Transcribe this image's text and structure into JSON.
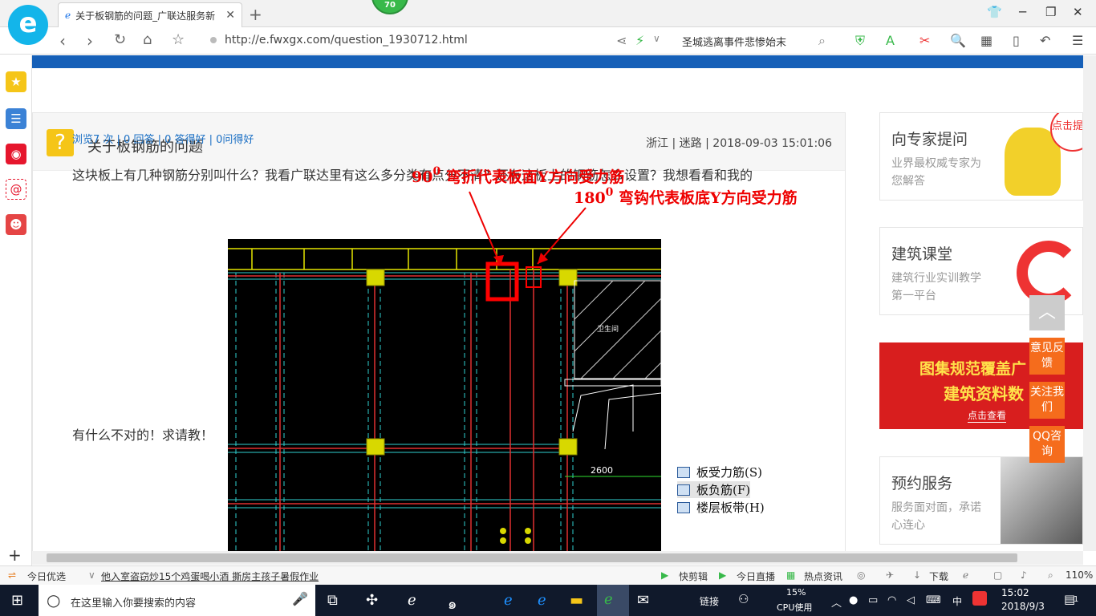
{
  "browser": {
    "tab_title": "关于板钢筋的问题_广联达服务新",
    "badge": "70",
    "url": "http://e.fwxgx.com/question_1930712.html",
    "search_text": "圣城逃离事件悲惨始末"
  },
  "question": {
    "title": "关于板钢筋的问题",
    "meta": "浙江 | 迷路 | 2018-09-03 15:01:06",
    "stats": "浏览7 次 | 0 回答 | 0 答得好 | 0问得好",
    "body_line1": "这块板上有几种钢筋分别叫什么？我看广联达里有这么多分类有点分不清？还有这板上的钢筋怎么设置？我想看看和我的",
    "body_line2": "有什么不对的！求请教！"
  },
  "image": {
    "annotation1_num": "90",
    "annotation1_sup": "0",
    "annotation1_text": "弯折代表板面Y方向受力筋",
    "annotation2_num": "180",
    "annotation2_sup": "0",
    "annotation2_text": "弯钩代表板底Y方向受力筋",
    "room_label": "卫生间",
    "dimension": "2600",
    "legend": [
      "板受力筋(S)",
      "板负筋(F)",
      "楼层板带(H)"
    ]
  },
  "sidebar": {
    "cards": [
      {
        "title": "向专家提问",
        "sub": "业界最权威专家为您解答"
      },
      {
        "title": "建筑课堂",
        "sub": "建筑行业实训教学第一平台"
      },
      {
        "title": "图集规范覆盖广",
        "sub": "建筑资料数",
        "cta": "点击查看"
      },
      {
        "title": "预约服务",
        "sub": "服务面对面，承诺心连心"
      }
    ],
    "corner_tag": "点击提问",
    "float_buttons": [
      "意见反馈",
      "关注我们",
      "QQ咨询"
    ]
  },
  "statusbar": {
    "left": "今日优选",
    "news": "他入室盗窃炒15个鸡蛋喝小酒 撕房主孩子暑假作业",
    "items": [
      "快剪辑",
      "今日直播",
      "热点资讯",
      "下载"
    ],
    "zoom": "110%"
  },
  "taskbar": {
    "search_placeholder": "在这里输入你要搜索的内容",
    "link_label": "链接",
    "cpu_percent": "15%",
    "cpu_label": "CPU使用",
    "ime": "中",
    "time": "15:02",
    "date": "2018/9/3",
    "notif_count": "1"
  },
  "colors": {
    "accent_blue": "#1660b8",
    "orange": "#f56c1c",
    "annotation_red": "#ee0000"
  }
}
